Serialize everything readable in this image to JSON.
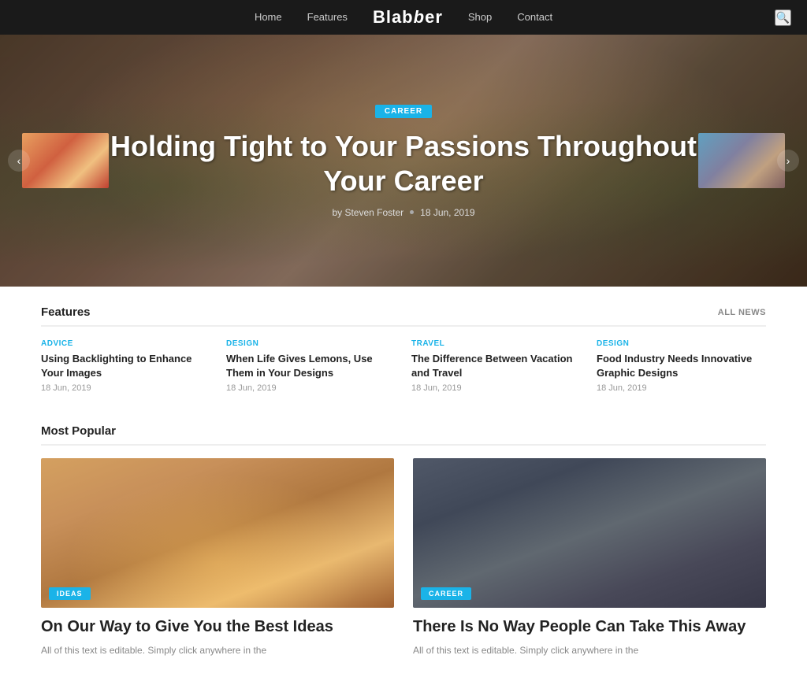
{
  "nav": {
    "links": [
      "Home",
      "Features",
      "Shop",
      "Contact"
    ],
    "logo": "Blabber",
    "search_aria": "Search"
  },
  "hero": {
    "tag": "CAREER",
    "title": "Holding Tight to Your Passions Throughout Your Career",
    "author": "by Steven Foster",
    "date": "18 Jun, 2019",
    "prev_aria": "Previous slide",
    "next_aria": "Next slide"
  },
  "features": {
    "section_title": "Features",
    "all_news_label": "ALL NEWS",
    "items": [
      {
        "category": "ADVICE",
        "title": "Using Backlighting to Enhance Your Images",
        "date": "18 Jun, 2019"
      },
      {
        "category": "DESIGN",
        "title": "When Life Gives Lemons, Use Them in Your Designs",
        "date": "18 Jun, 2019"
      },
      {
        "category": "TRAVEL",
        "title": "The Difference Between Vacation and Travel",
        "date": "18 Jun, 2019"
      },
      {
        "category": "DESIGN",
        "title": "Food Industry Needs Innovative Graphic Designs",
        "date": "18 Jun, 2019"
      }
    ]
  },
  "popular": {
    "section_title": "Most Popular",
    "cards": [
      {
        "tag": "IDEAS",
        "title": "On Our Way to Give You the Best Ideas",
        "desc": "All of this text is editable. Simply click anywhere in the"
      },
      {
        "tag": "CAREER",
        "title": "There Is No Way People Can Take This Away",
        "desc": "All of this text is editable. Simply click anywhere in the"
      }
    ]
  }
}
